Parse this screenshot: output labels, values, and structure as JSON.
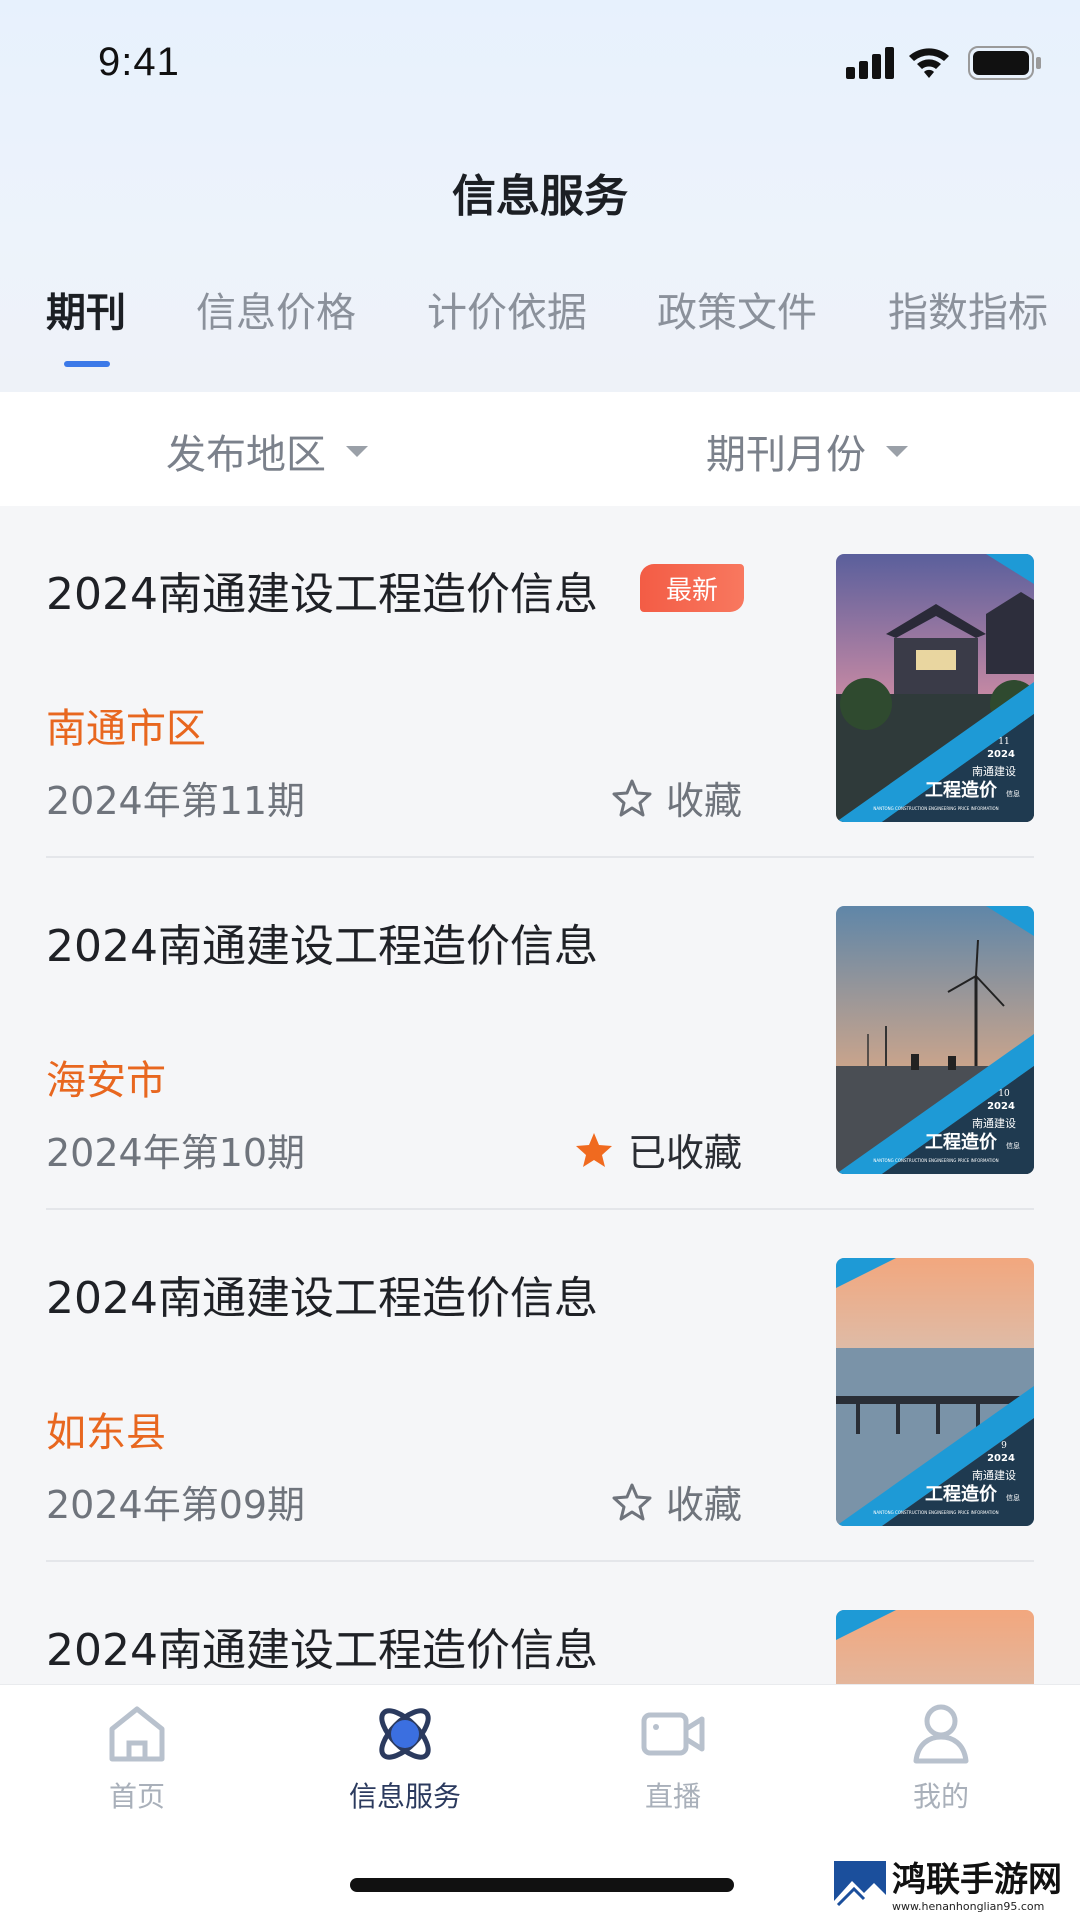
{
  "status_bar": {
    "time": "9:41"
  },
  "header": {
    "title": "信息服务"
  },
  "tabs": [
    {
      "label": "期刊",
      "active": true
    },
    {
      "label": "信息价格",
      "active": false
    },
    {
      "label": "计价依据",
      "active": false
    },
    {
      "label": "政策文件",
      "active": false
    },
    {
      "label": "指数指标",
      "active": false
    }
  ],
  "filters": {
    "region": "发布地区",
    "month": "期刊月份"
  },
  "items": [
    {
      "title": "2024南通建设工程造价信息",
      "badge": "最新",
      "region": "南通市区",
      "issue": "2024年第11期",
      "favorite_label": "收藏",
      "favorited": false,
      "cover": {
        "number": "11",
        "year": "2024",
        "brand": "南通建设",
        "name": "工程造价",
        "tag": "信息",
        "subtitle": "NANTONG CONSTRUCTION ENGINEERING PRICE INFORMATION"
      }
    },
    {
      "title": "2024南通建设工程造价信息",
      "badge": "",
      "region": "海安市",
      "issue": "2024年第10期",
      "favorite_label": "已收藏",
      "favorited": true,
      "cover": {
        "number": "10",
        "year": "2024",
        "brand": "南通建设",
        "name": "工程造价",
        "tag": "信息",
        "subtitle": "NANTONG CONSTRUCTION ENGINEERING PRICE INFORMATION"
      }
    },
    {
      "title": "2024南通建设工程造价信息",
      "badge": "",
      "region": "如东县",
      "issue": "2024年第09期",
      "favorite_label": "收藏",
      "favorited": false,
      "cover": {
        "number": "9",
        "year": "2024",
        "brand": "南通建设",
        "name": "工程造价",
        "tag": "信息",
        "subtitle": "NANTONG CONSTRUCTION ENGINEERING PRICE INFORMATION"
      }
    },
    {
      "title": "2024南通建设工程造价信息"
    }
  ],
  "bottom_nav": [
    {
      "label": "首页",
      "icon": "home-icon",
      "active": false
    },
    {
      "label": "信息服务",
      "icon": "atom-icon",
      "active": true
    },
    {
      "label": "直播",
      "icon": "video-camera-icon",
      "active": false
    },
    {
      "label": "我的",
      "icon": "person-icon",
      "active": false
    }
  ],
  "watermark": {
    "main": "鸿联手游网",
    "sub": "www.henanhonglian95.com"
  },
  "colors": {
    "accent": "#3b79e8",
    "region": "#e8671f",
    "badge": "#f35c45",
    "star": "#f06a1f"
  }
}
